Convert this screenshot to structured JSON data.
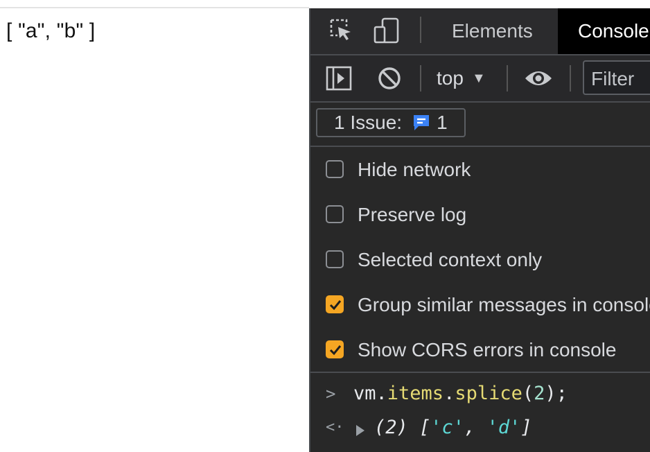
{
  "page": {
    "output_text": "[ \"a\", \"b\" ]"
  },
  "devtools": {
    "tabs": [
      {
        "label": "Elements",
        "active": false
      },
      {
        "label": "Console",
        "active": true
      }
    ],
    "toolbar": {
      "context_label": "top",
      "filter_placeholder": "Filter"
    },
    "issues": {
      "label": "1 Issue:",
      "count": "1"
    },
    "settings": [
      {
        "label": "Hide network",
        "checked": false
      },
      {
        "label": "Preserve log",
        "checked": false
      },
      {
        "label": "Selected context only",
        "checked": false
      },
      {
        "label": "Group similar messages in console",
        "checked": true
      },
      {
        "label": "Show CORS errors in console",
        "checked": true
      }
    ],
    "console": {
      "input": {
        "obj": "vm",
        "dot1": ".",
        "prop": "items",
        "dot2": ".",
        "method": "splice",
        "open": "(",
        "arg": "2",
        "close": ");"
      },
      "result": {
        "count": "(2)",
        "open": " [",
        "item1": "'c'",
        "sep": ", ",
        "item2": "'d'",
        "close": "]"
      }
    },
    "colors": {
      "accent_checkbox": "#f5a623",
      "issue_icon": "#3b82f6"
    }
  }
}
